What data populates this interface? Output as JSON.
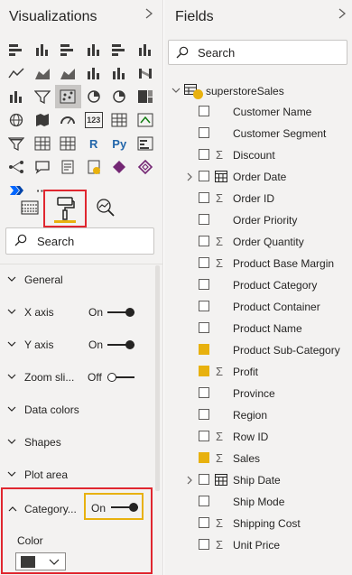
{
  "visualizations": {
    "title": "Visualizations",
    "collapse_icon": "chevron-right-icon",
    "grid": [
      [
        "stacked-bar-icon",
        "stacked-column-icon",
        "clustered-bar-icon",
        "clustered-column-icon",
        "100-bar-icon",
        "100-column-icon"
      ],
      [
        "line-chart-icon",
        "area-chart-icon",
        "stacked-area-icon",
        "line-column-icon",
        "line-clustered-icon",
        "ribbon-chart-icon"
      ],
      [
        "waterfall-icon",
        "funnel-icon",
        "scatter-icon",
        "pie-icon",
        "donut-icon",
        "treemap-icon"
      ],
      [
        "map-icon",
        "filled-map-icon",
        "gauge-icon",
        "card-icon",
        "multi-card-icon",
        "kpi-icon"
      ],
      [
        "slicer-icon",
        "table-icon",
        "matrix-icon",
        "r-visual-icon",
        "python-visual-icon",
        "key-influencers-icon"
      ],
      [
        "decomposition-tree-icon",
        "qa-icon",
        "smart-narrative-icon",
        "paginated-icon",
        "powerapps-icon",
        "power-automate-icon"
      ],
      [
        "power-automate-arrows-icon",
        "more-icon"
      ]
    ],
    "glyphs": {
      "r": "R",
      "py": "Py",
      "card": "123",
      "more": "···"
    },
    "tabs": [
      "fields-tab-icon",
      "format-tab-icon",
      "analytics-tab-icon"
    ],
    "search_placeholder": "Search",
    "sections": [
      {
        "label": "General",
        "toggle": null
      },
      {
        "label": "X axis",
        "toggle": "On"
      },
      {
        "label": "Y axis",
        "toggle": "On"
      },
      {
        "label": "Zoom sli...",
        "toggle": "Off"
      },
      {
        "label": "Data colors",
        "toggle": null
      },
      {
        "label": "Shapes",
        "toggle": null
      },
      {
        "label": "Plot area",
        "toggle": null
      }
    ],
    "category": {
      "label": "Category...",
      "toggle": "On",
      "color_label": "Color",
      "color_value": "#3b3a39"
    }
  },
  "fields": {
    "title": "Fields",
    "collapse_icon": "chevron-right-icon",
    "search_placeholder": "Search",
    "table_name": "superstoreSales",
    "items": [
      {
        "name": "Customer Name",
        "type": "text",
        "checked": false,
        "expandable": false
      },
      {
        "name": "Customer Segment",
        "type": "text",
        "checked": false,
        "expandable": false
      },
      {
        "name": "Discount",
        "type": "sum",
        "checked": false,
        "expandable": false
      },
      {
        "name": "Order Date",
        "type": "date",
        "checked": false,
        "expandable": true
      },
      {
        "name": "Order ID",
        "type": "sum",
        "checked": false,
        "expandable": false
      },
      {
        "name": "Order Priority",
        "type": "text",
        "checked": false,
        "expandable": false
      },
      {
        "name": "Order Quantity",
        "type": "sum",
        "checked": false,
        "expandable": false
      },
      {
        "name": "Product Base Margin",
        "type": "sum",
        "checked": false,
        "expandable": false
      },
      {
        "name": "Product Category",
        "type": "text",
        "checked": false,
        "expandable": false
      },
      {
        "name": "Product Container",
        "type": "text",
        "checked": false,
        "expandable": false
      },
      {
        "name": "Product Name",
        "type": "text",
        "checked": false,
        "expandable": false
      },
      {
        "name": "Product Sub-Category",
        "type": "text",
        "checked": true,
        "expandable": false
      },
      {
        "name": "Profit",
        "type": "sum",
        "checked": true,
        "expandable": false
      },
      {
        "name": "Province",
        "type": "text",
        "checked": false,
        "expandable": false
      },
      {
        "name": "Region",
        "type": "text",
        "checked": false,
        "expandable": false
      },
      {
        "name": "Row ID",
        "type": "sum",
        "checked": false,
        "expandable": false
      },
      {
        "name": "Sales",
        "type": "sum",
        "checked": true,
        "expandable": false
      },
      {
        "name": "Ship Date",
        "type": "date",
        "checked": false,
        "expandable": true
      },
      {
        "name": "Ship Mode",
        "type": "text",
        "checked": false,
        "expandable": false
      },
      {
        "name": "Shipping Cost",
        "type": "sum",
        "checked": false,
        "expandable": false
      },
      {
        "name": "Unit Price",
        "type": "sum",
        "checked": false,
        "expandable": false
      }
    ]
  },
  "colors": {
    "accent": "#e8b10e",
    "highlight": "#e0262f"
  }
}
